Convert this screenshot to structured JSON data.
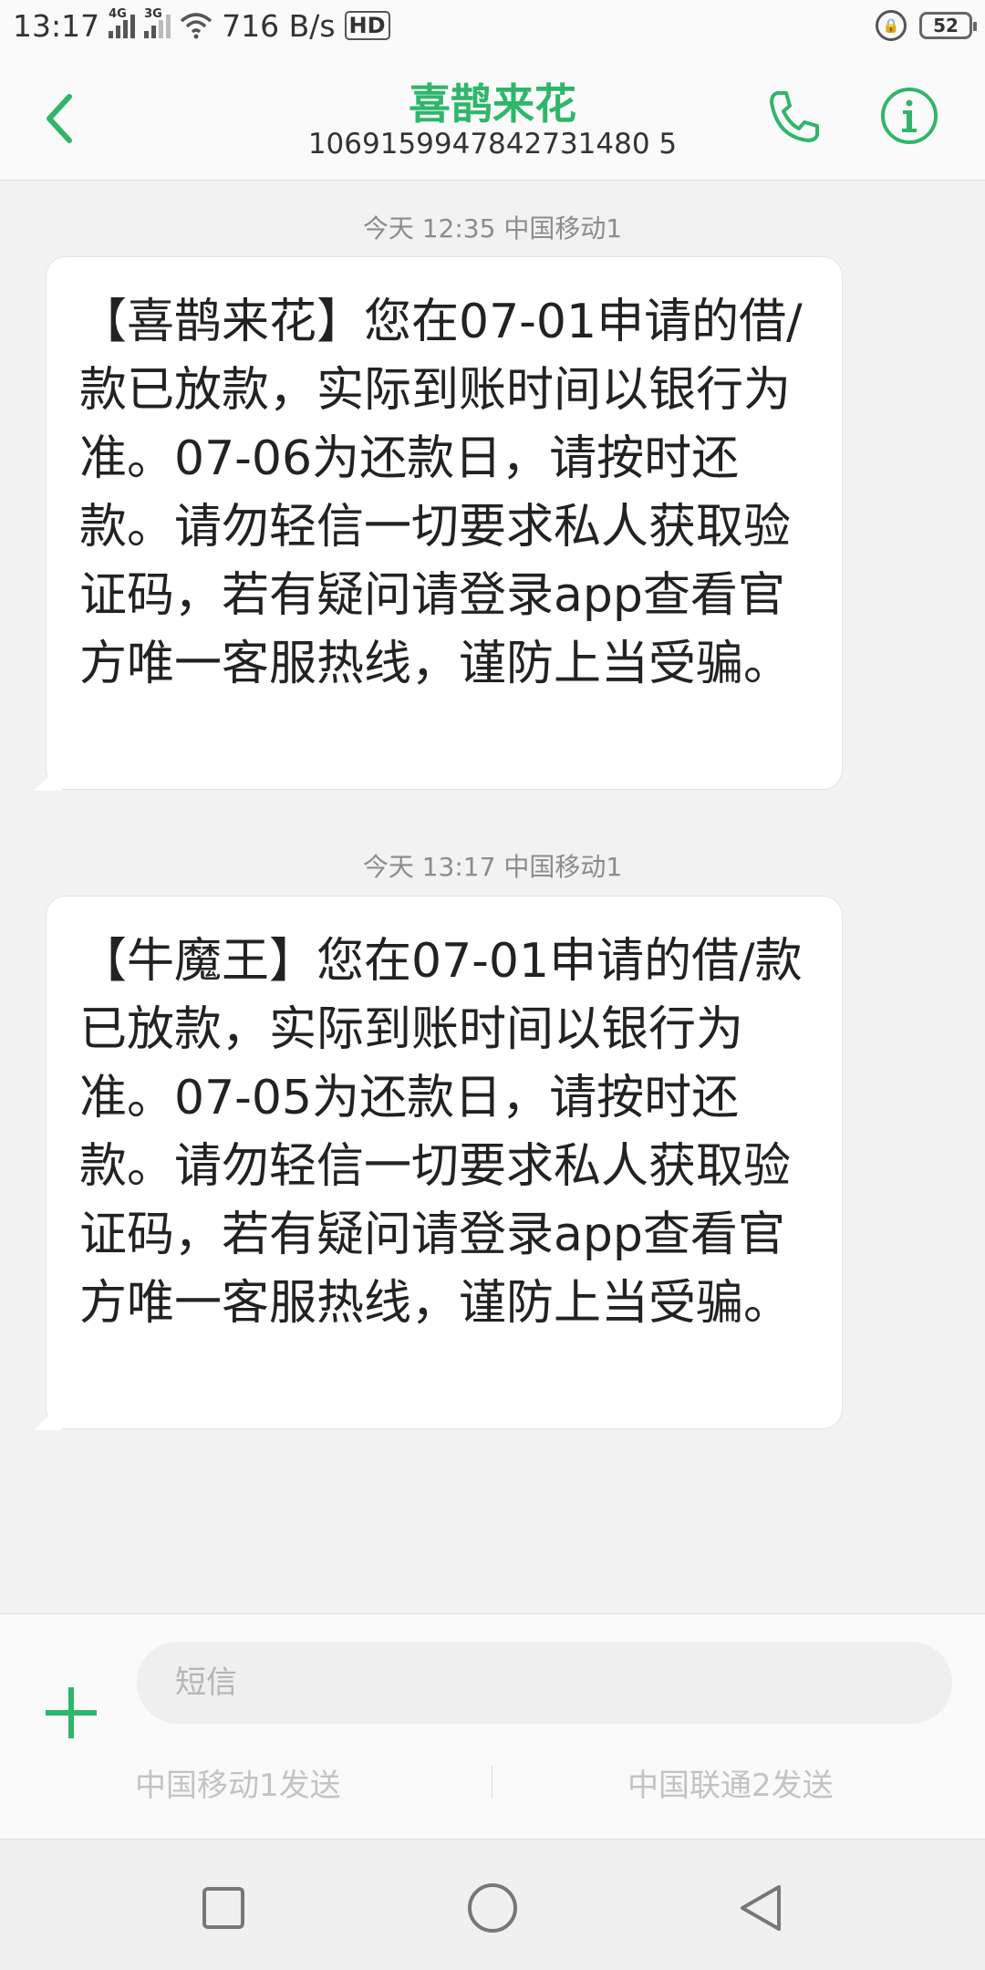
{
  "status_bar": {
    "time": "13:17",
    "net1": "4G",
    "net2": "3G",
    "speed": "716 B/s",
    "hd": "HD",
    "battery": "52"
  },
  "header": {
    "title": "喜鹊来花",
    "number": "1069159947842731480 5"
  },
  "messages": [
    {
      "timestamp": "今天 12:35  中国移动1",
      "text": "【喜鹊来花】您在07-01申请的借/款已放款，实际到账时间以银行为准。07-06为还款日，请按时还款。请勿轻信一切要求私人获取验证码，若有疑问请登录app查看官方唯一客服热线，谨防上当受骗。"
    },
    {
      "timestamp": "今天 13:17  中国移动1",
      "text": "【牛魔王】您在07-01申请的借/款已放款，实际到账时间以银行为准。07-05为还款日，请按时还款。请勿轻信一切要求私人获取验证码，若有疑问请登录app查看官方唯一客服热线，谨防上当受骗。"
    }
  ],
  "composer": {
    "placeholder": "短信",
    "send_sim1": "中国移动1发送",
    "send_sim2": "中国联通2发送"
  },
  "colors": {
    "accent": "#2fb66a"
  }
}
